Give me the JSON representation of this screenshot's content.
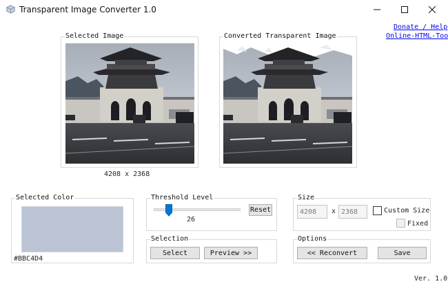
{
  "window": {
    "title": "Transparent Image Converter 1.0",
    "icon": "app-icon",
    "controls": [
      "minimize-icon",
      "maximize-icon",
      "close-icon"
    ]
  },
  "links": {
    "donate": "Donate / Help",
    "tools": "Online-HTML-Tools"
  },
  "selected_image": {
    "title": "Selected Image",
    "dimensions": "4208 x 2368"
  },
  "converted_image": {
    "title": "Converted Transparent Image"
  },
  "selected_color": {
    "title": "Selected Color",
    "hex": "#BBC4D4"
  },
  "threshold": {
    "title": "Threshold Level",
    "value": "26",
    "slider_fraction": 0.15,
    "reset_label": "Reset"
  },
  "selection": {
    "title": "Selection",
    "select_label": "Select",
    "preview_label": "Preview >>"
  },
  "size": {
    "title": "Size",
    "width": "4208",
    "separator": "x",
    "height": "2368",
    "custom_size_label": "Custom Size",
    "fixed_label": "Fixed",
    "custom_size_checked": false,
    "fixed_checked": false
  },
  "options": {
    "title": "Options",
    "reconvert_label": "<< Reconvert",
    "save_label": "Save"
  },
  "version": "Ver. 1.0",
  "colors": {
    "selected_swatch": "#BBC4D4",
    "link": "#0000EE",
    "button_bg": "#E4E4E4",
    "slider_thumb": "#0078D7"
  }
}
